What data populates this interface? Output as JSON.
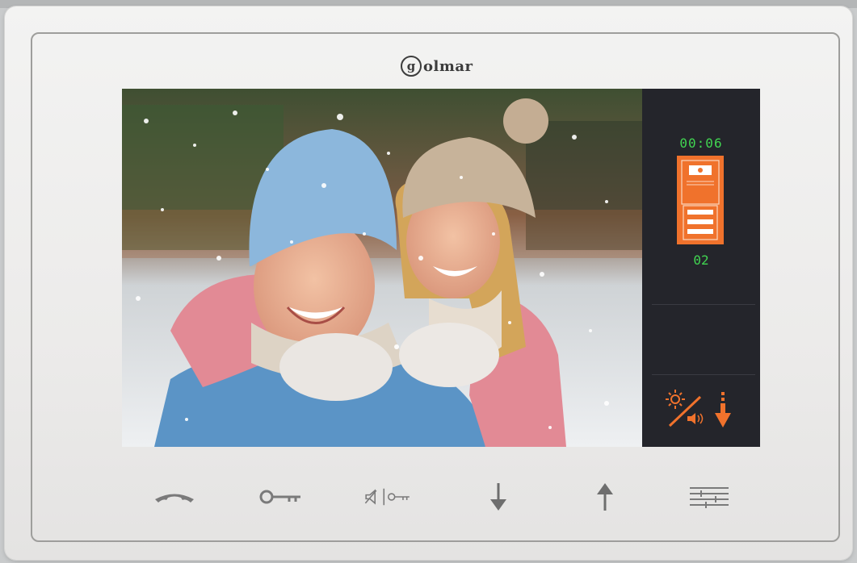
{
  "brand": {
    "logo_letter": "g",
    "logo_text": "olmar"
  },
  "call_panel": {
    "timer": "00:06",
    "apartment": "02",
    "panel_icon": "door-panel-icon",
    "accent_color": "#f0722c",
    "text_color": "#41d451"
  },
  "controls": {
    "brightness_volume_icon": "brightness-volume-icon",
    "download_icon": "down-arrow-icon"
  },
  "buttons": [
    {
      "name": "hang-up",
      "icon": "handset-icon"
    },
    {
      "name": "door-open",
      "icon": "key-icon"
    },
    {
      "name": "mute-key",
      "icon": "mute-key-icon"
    },
    {
      "name": "down",
      "icon": "arrow-down-icon"
    },
    {
      "name": "up",
      "icon": "arrow-up-icon"
    },
    {
      "name": "menu",
      "icon": "sliders-icon"
    }
  ],
  "colors": {
    "device_body": "#efeeed",
    "screen_bg": "#24252b",
    "icon_gray": "#7a7a7a"
  }
}
